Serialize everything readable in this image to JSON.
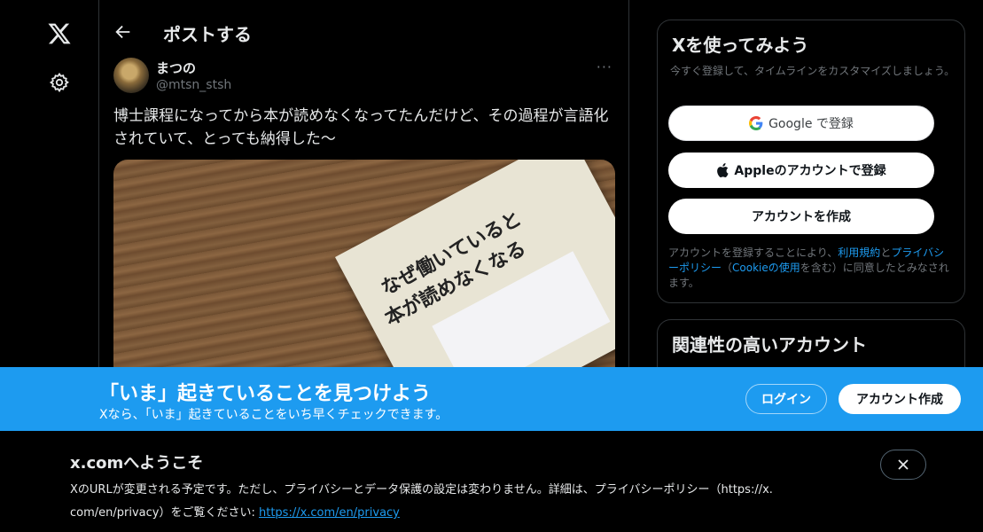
{
  "header": {
    "title": "ポストする"
  },
  "tweet": {
    "author_name": "まつの",
    "author_handle": "@mtsn_stsh",
    "more": "···",
    "text_line1": "博士課程になってから本が読めなくなってたんだけど、その過程が言語化",
    "text_line2": "されていて、とっても納得した〜",
    "media_text_line1": "なぜ働いていると",
    "media_text_line2": "本が読めなくなる"
  },
  "signup_card": {
    "title": "Xを使ってみよう",
    "subtitle": "今すぐ登録して、タイムラインをカスタマイズしましょう。",
    "google_button": "Google で登録",
    "apple_button": "Appleのアカウントで登録",
    "create_button": "アカウントを作成",
    "terms_prefix": "アカウントを登録することにより、",
    "terms_link": "利用規約",
    "terms_and": "と",
    "privacy_link": "プライバシーポリシー",
    "terms_mid": "（",
    "cookie_link": "Cookieの使用",
    "terms_suffix": "を含む）に同意したとみなされます。"
  },
  "related_card": {
    "title": "関連性の高いアカウント"
  },
  "banner": {
    "title": "「いま」起きていることを見つけよう",
    "subtitle": "Xなら、「いま」起きていることをいち早くチェックできます。",
    "login": "ログイン",
    "signup": "アカウント作成"
  },
  "notice": {
    "title": "x.comへようこそ",
    "text_line1": "XのURLが変更される予定です。ただし、プライバシーとデータ保護の設定は変わりません。詳細は、プライバシーポリシー（https://x.",
    "text_line2": "com/en/privacy）をご覧ください: ",
    "link": "https://x.com/en/privacy"
  },
  "icons": [
    "x-logo-icon",
    "gear-icon",
    "back-arrow-icon",
    "google-icon",
    "apple-icon",
    "close-icon"
  ],
  "colors": {
    "accent": "#1d9bf0",
    "background": "#000000",
    "muted": "#71767b"
  }
}
